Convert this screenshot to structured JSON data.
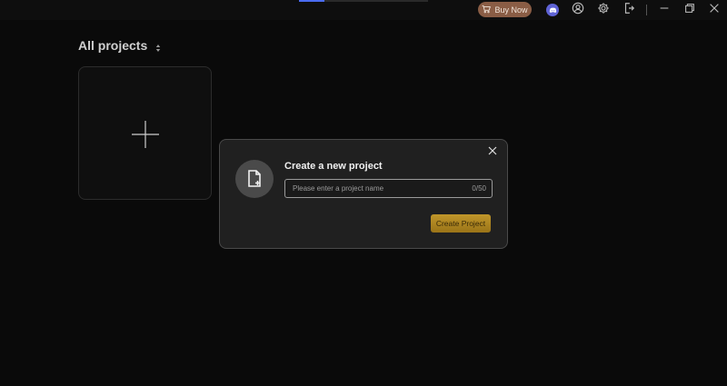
{
  "titlebar": {
    "progress": 0.2,
    "buy_now_label": "Buy Now",
    "accent_buy_now": "#8a5d45",
    "accent_discord": "#5f63d6",
    "icons": [
      "cart-icon",
      "discord-icon",
      "user-icon",
      "gear-icon",
      "logout-icon",
      "minimize-icon",
      "restore-icon",
      "close-icon"
    ]
  },
  "main": {
    "title": "All projects",
    "new_project_card_icon": "plus-icon"
  },
  "dialog": {
    "title": "Create a new project",
    "input_placeholder": "Please enter a project name",
    "input_value": "",
    "char_count": "0/50",
    "create_button_label": "Create Project",
    "icon": "new-file-icon",
    "accent_create": "#b58a22"
  }
}
